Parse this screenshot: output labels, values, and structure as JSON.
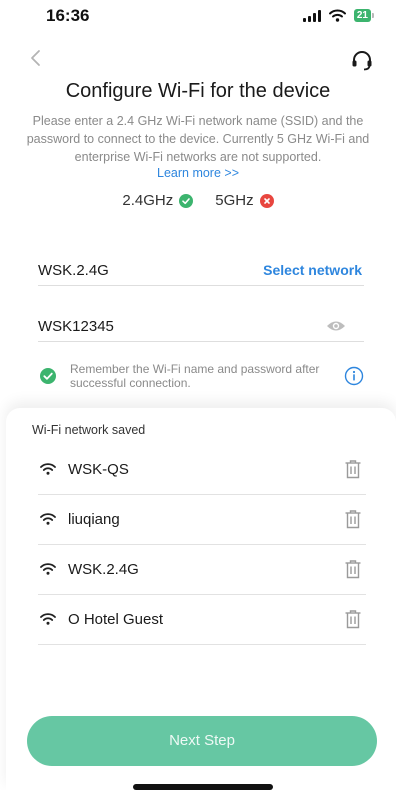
{
  "status_bar": {
    "time": "16:36",
    "battery": "21"
  },
  "header": {
    "title": "Configure Wi-Fi for the device",
    "description": "Please enter a 2.4 GHz Wi-Fi network name (SSID) and the password to connect to the device. Currently 5 GHz Wi-Fi and enterprise Wi-Fi networks are not supported.",
    "learn_more": "Learn more >>"
  },
  "bands": {
    "band_24": "2.4GHz",
    "band_5": "5GHz"
  },
  "form": {
    "ssid_value": "WSK.2.4G",
    "select_network": "Select network",
    "password_value": "WSK12345",
    "remember_text": "Remember the Wi-Fi name and password after successful connection."
  },
  "saved": {
    "title": "Wi-Fi network saved",
    "items": [
      {
        "name": "WSK-QS"
      },
      {
        "name": "liuqiang"
      },
      {
        "name": "WSK.2.4G"
      },
      {
        "name": "O Hotel Guest"
      }
    ]
  },
  "footer": {
    "next_label": "Next Step"
  },
  "colors": {
    "accent": "#66c7a3",
    "link": "#2e86de",
    "success": "#3cb46e",
    "error": "#e8463f"
  }
}
